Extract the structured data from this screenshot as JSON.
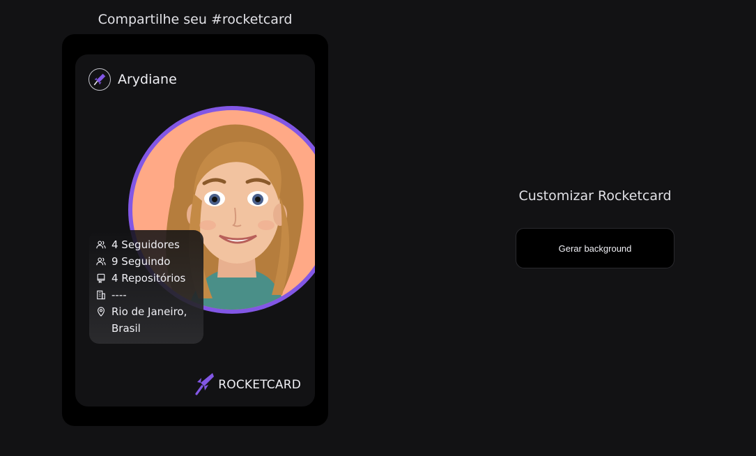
{
  "share": {
    "title": "Compartilhe seu #rocketcard"
  },
  "card": {
    "user_name": "Arydiane",
    "user_icon": "rocket-icon",
    "avatar_icon": "avatar-icon",
    "stats": {
      "followers": "4 Seguidores",
      "following": "9 Seguindo",
      "repositories": "4 Repositórios",
      "company": "----",
      "location": "Rio de Janeiro, Brasil"
    },
    "stat_icons": [
      "followers-icon",
      "following-icon",
      "repository-icon",
      "company-icon",
      "location-pin-icon"
    ],
    "brand_label": "ROCKETCARD",
    "brand_icon": "rocket-logo-icon"
  },
  "customize": {
    "title": "Customizar Rocketcard",
    "button_label": "Gerar background"
  },
  "colors": {
    "background": "#121214",
    "card_frame": "#000000",
    "accent": "#8257e5",
    "avatar_bg": "#ffa986"
  }
}
